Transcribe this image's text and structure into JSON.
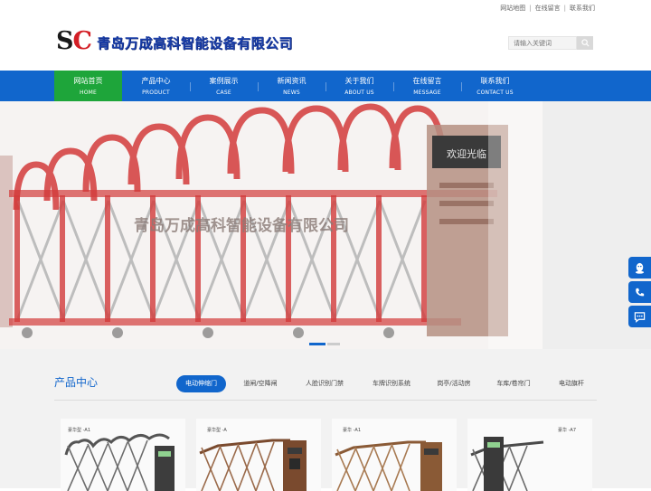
{
  "topbar": {
    "links": [
      "网站地图",
      "在线留言",
      "联系我们"
    ]
  },
  "header": {
    "logo_s": "S",
    "logo_c": "C",
    "company_name": "青岛万成高科智能设备有限公司",
    "search": {
      "placeholder": "请输入关键词"
    }
  },
  "nav": {
    "items": [
      {
        "zh": "网站首页",
        "en": "HOME"
      },
      {
        "zh": "产品中心",
        "en": "PRODUCT"
      },
      {
        "zh": "案例展示",
        "en": "CASE"
      },
      {
        "zh": "新闻资讯",
        "en": "NEWS"
      },
      {
        "zh": "关于我们",
        "en": "ABOUT US"
      },
      {
        "zh": "在线留言",
        "en": "MESSAGE"
      },
      {
        "zh": "联系我们",
        "en": "CONTACT US"
      }
    ],
    "active_index": 0
  },
  "banner": {
    "overlay_text": "青岛万成高科智能设备有限公司",
    "booth_sign": "欢迎光临",
    "slide_count": 2,
    "current_slide": 0
  },
  "side_tools": [
    "qq-icon",
    "phone-icon",
    "chat-icon"
  ],
  "products": {
    "title": "产品中心",
    "tabs": [
      "电动伸缩门",
      "道闸/空降闸",
      "人脸识别门禁",
      "车牌识别系统",
      "岗亭/活动房",
      "车库/卷帘门",
      "电动旗杆"
    ],
    "active_tab": 0,
    "cards": [
      {
        "tag": "豪华型 -A1",
        "finish": "dark"
      },
      {
        "tag": "豪华型 -A",
        "finish": "bronze"
      },
      {
        "tag": "豪华 -A1",
        "finish": "bronze"
      },
      {
        "tag": "豪华 -A7",
        "finish": "dark"
      }
    ]
  },
  "colors": {
    "nav_blue": "#1166cc",
    "active_green": "#1ea53a",
    "logo_red": "#d31f26",
    "brand_blue": "#1a3ea8"
  }
}
